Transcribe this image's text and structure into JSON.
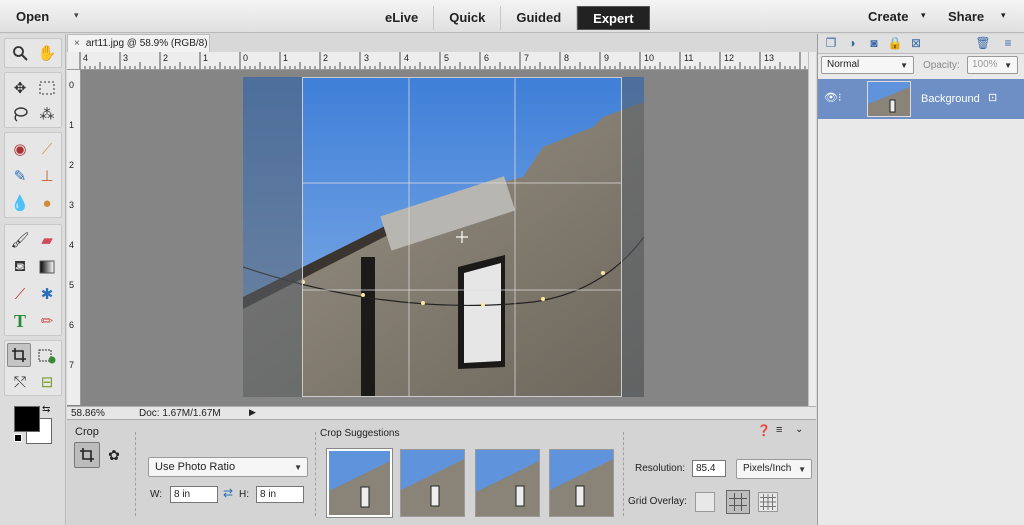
{
  "topbar": {
    "open_label": "Open",
    "modes": [
      "eLive",
      "Quick",
      "Guided",
      "Expert"
    ],
    "active_mode": "Expert",
    "create_label": "Create",
    "share_label": "Share"
  },
  "document": {
    "tab_title": "art11.jpg @ 58.9% (RGB/8)",
    "ruler_top": [
      "4",
      "3",
      "2",
      "1",
      "0",
      "1",
      "2",
      "3",
      "4",
      "5",
      "6",
      "7",
      "8",
      "9",
      "10",
      "11",
      "12",
      "13"
    ],
    "ruler_left": [
      "0",
      "1",
      "2",
      "3",
      "4",
      "5",
      "6",
      "7"
    ]
  },
  "status": {
    "zoom": "58.86%",
    "doc_size": "Doc: 1.67M/1.67M"
  },
  "crop_options": {
    "title": "Crop",
    "ratio_select": "Use Photo Ratio",
    "w_label": "W:",
    "w_value": "8 in",
    "h_label": "H:",
    "h_value": "8 in",
    "suggestions_title": "Crop Suggestions",
    "resolution_label": "Resolution:",
    "resolution_value": "85.4",
    "resolution_unit": "Pixels/Inch",
    "grid_overlay_label": "Grid Overlay:"
  },
  "layers": {
    "blend_mode": "Normal",
    "opacity_label": "Opacity:",
    "opacity_value": "100%",
    "items": [
      {
        "name": "Background"
      }
    ]
  },
  "colors": {
    "sky": "#5f93dc",
    "wall": "#8a8378",
    "accent": "#6d8fc5",
    "expert_bg": "#222222"
  },
  "icons": [
    "zoom-icon",
    "hand-icon",
    "move-icon",
    "marquee-icon",
    "lasso-icon",
    "magic-wand-icon",
    "red-eye-icon",
    "spot-heal-icon",
    "smart-brush-icon",
    "clone-stamp-icon",
    "blur-icon",
    "sponge-icon",
    "brush-icon",
    "eraser-icon",
    "paint-bucket-icon",
    "gradient-icon",
    "eyedropper-icon",
    "custom-shape-icon",
    "type-icon",
    "pencil-icon",
    "crop-icon",
    "recompose-icon",
    "content-aware-move-icon",
    "straighten-icon"
  ]
}
